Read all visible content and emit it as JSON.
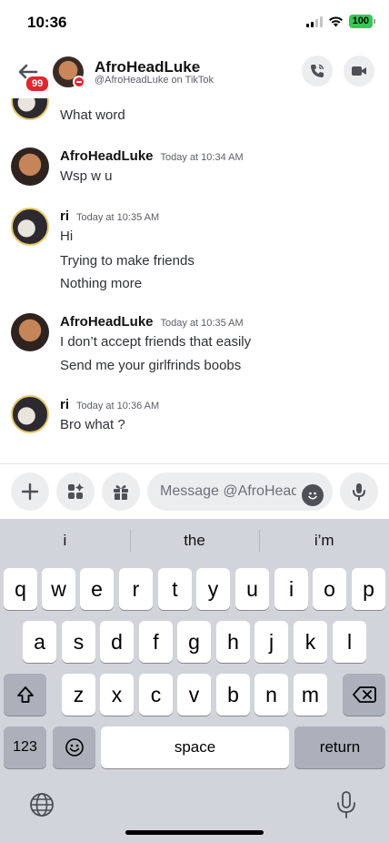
{
  "status": {
    "time": "10:36",
    "battery": "100"
  },
  "header": {
    "badge": "99",
    "name": "AfroHeadLuke",
    "chevron": "›",
    "subtitle": "@AfroHeadLuke on TikTok"
  },
  "messages": [
    {
      "author": "",
      "time": "",
      "lines": [
        "What word"
      ]
    },
    {
      "author": "AfroHeadLuke",
      "time": "Today at 10:34 AM",
      "lines": [
        "Wsp w u"
      ]
    },
    {
      "author": "ri",
      "time": "Today at 10:35 AM",
      "lines": [
        "Hi",
        "Trying to make friends",
        "Nothing more"
      ]
    },
    {
      "author": "AfroHeadLuke",
      "time": "Today at 10:35 AM",
      "lines": [
        "I don’t accept friends that easily",
        "Send me your girlfrinds boobs"
      ]
    },
    {
      "author": "ri",
      "time": "Today at 10:36 AM",
      "lines": [
        "Bro what ?"
      ]
    }
  ],
  "composer": {
    "placeholder": "Message @AfroHead…"
  },
  "keyboard": {
    "suggestions": [
      "i",
      "the",
      "i’m"
    ],
    "row1": [
      "q",
      "w",
      "e",
      "r",
      "t",
      "y",
      "u",
      "i",
      "o",
      "p"
    ],
    "row2": [
      "a",
      "s",
      "d",
      "f",
      "g",
      "h",
      "j",
      "k",
      "l"
    ],
    "row3": [
      "z",
      "x",
      "c",
      "v",
      "b",
      "n",
      "m"
    ],
    "numbers_label": "123",
    "space_label": "space",
    "return_label": "return"
  },
  "icons": {
    "back": "back-arrow-icon",
    "call": "phone-icon",
    "video": "video-camera-icon",
    "plus": "plus-icon",
    "apps": "apps-icon",
    "gift": "gift-icon",
    "emoji": "emoji-icon",
    "mic": "microphone-icon",
    "shift": "shift-icon",
    "delete": "backspace-icon",
    "globe": "globe-icon",
    "dictation": "dictation-icon"
  },
  "colors": {
    "badge": "#e0272f",
    "battery": "#34c759",
    "keyboard_bg": "#d1d4db"
  }
}
